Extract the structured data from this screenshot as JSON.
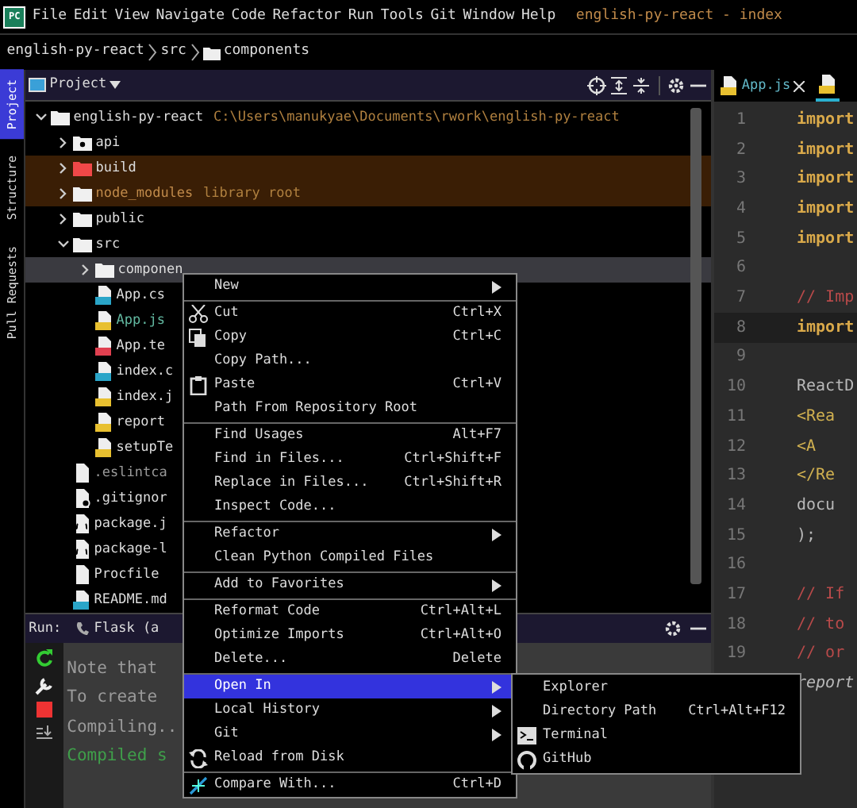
{
  "app_logo": "PC",
  "menu_bar": [
    "File",
    "Edit",
    "View",
    "Navigate",
    "Code",
    "Refactor",
    "Run",
    "Tools",
    "Git",
    "Window",
    "Help"
  ],
  "window": {
    "title": "english-py-react - index"
  },
  "breadcrumb": [
    "english-py-react",
    "src",
    "components"
  ],
  "tool_stripe": [
    {
      "label": "Project",
      "selected": true
    },
    {
      "label": "Structure",
      "selected": false
    },
    {
      "label": "Pull Requests",
      "selected": false
    }
  ],
  "project_panel": {
    "title": "Project",
    "tree": [
      {
        "label": "english-py-react",
        "hint": "C:\\Users\\manukyae\\Documents\\rwork\\english-py-react",
        "kind": "folder",
        "color": "#dddddd",
        "excluded": false,
        "highlighted": false,
        "selected": false,
        "expanded": true,
        "children": [
          {
            "label": "api",
            "kind": "package",
            "color": "#dddddd",
            "excluded": false,
            "highlighted": false,
            "selected": false,
            "expanded": false
          },
          {
            "label": "build",
            "kind": "folder",
            "color": "#dddddd",
            "excluded": true,
            "highlighted": true,
            "selected": false,
            "expanded": false
          },
          {
            "label": "node_modules",
            "hint": "library root",
            "kind": "folder",
            "color": "#c08a4a",
            "excluded": false,
            "highlighted": true,
            "selected": false,
            "expanded": false
          },
          {
            "label": "public",
            "kind": "folder",
            "color": "#dddddd",
            "excluded": false,
            "highlighted": false,
            "selected": false,
            "expanded": false
          },
          {
            "label": "src",
            "kind": "folder",
            "color": "#dddddd",
            "excluded": false,
            "highlighted": false,
            "selected": false,
            "expanded": true,
            "children": [
              {
                "label": "componen",
                "kind": "folder",
                "color": "#dddddd",
                "excluded": false,
                "highlighted": false,
                "selected": true,
                "expanded": false
              },
              {
                "label": "App.cs",
                "kind": "css",
                "color": "#dddddd",
                "excluded": false,
                "highlighted": false,
                "selected": false
              },
              {
                "label": "App.js",
                "kind": "js",
                "color": "#62b8a0",
                "excluded": false,
                "highlighted": false,
                "selected": false
              },
              {
                "label": "App.te",
                "kind": "test",
                "color": "#dddddd",
                "excluded": false,
                "highlighted": false,
                "selected": false
              },
              {
                "label": "index.c",
                "kind": "css",
                "color": "#dddddd",
                "excluded": false,
                "highlighted": false,
                "selected": false
              },
              {
                "label": "index.j",
                "kind": "js",
                "color": "#dddddd",
                "excluded": false,
                "highlighted": false,
                "selected": false
              },
              {
                "label": "report",
                "kind": "js",
                "color": "#dddddd",
                "excluded": false,
                "highlighted": false,
                "selected": false
              },
              {
                "label": "setupTe",
                "kind": "js",
                "color": "#dddddd",
                "excluded": false,
                "highlighted": false,
                "selected": false
              }
            ]
          },
          {
            "label": ".eslintca",
            "kind": "text",
            "color": "#9a9a9a",
            "excluded": false,
            "highlighted": false,
            "selected": false
          },
          {
            "label": ".gitignor",
            "kind": "ignore",
            "color": "#dddddd",
            "excluded": false,
            "highlighted": false,
            "selected": false
          },
          {
            "label": "package.j",
            "kind": "json",
            "color": "#dddddd",
            "excluded": false,
            "highlighted": false,
            "selected": false
          },
          {
            "label": "package-l",
            "kind": "json",
            "color": "#dddddd",
            "excluded": false,
            "highlighted": false,
            "selected": false
          },
          {
            "label": "Procfile",
            "kind": "text",
            "color": "#dddddd",
            "excluded": false,
            "highlighted": false,
            "selected": false
          },
          {
            "label": "README.md",
            "kind": "md",
            "color": "#dddddd",
            "excluded": false,
            "highlighted": false,
            "selected": false
          }
        ]
      }
    ]
  },
  "run_panel": {
    "label": "Run:",
    "config": "Flask (a",
    "console": [
      {
        "text": "Note that",
        "kind": "info"
      },
      {
        "text": "To create",
        "kind": "info"
      },
      {
        "text": "Compiling..",
        "kind": "info"
      },
      {
        "text": "Compiled s",
        "kind": "success"
      }
    ]
  },
  "editor": {
    "tabs": [
      {
        "label": "App.js",
        "selected": false
      },
      {
        "selected": true
      }
    ],
    "lines": [
      {
        "number": "1",
        "code": "import",
        "kind": "keyword",
        "selected": false
      },
      {
        "number": "2",
        "code": "import",
        "kind": "keyword",
        "selected": false
      },
      {
        "number": "3",
        "code": "import",
        "kind": "keyword",
        "selected": false
      },
      {
        "number": "4",
        "code": "import",
        "kind": "keyword",
        "selected": false
      },
      {
        "number": "5",
        "code": "import",
        "kind": "keyword",
        "selected": false
      },
      {
        "number": "6",
        "selected": false
      },
      {
        "number": "7",
        "code": "// Imp",
        "kind": "comment",
        "selected": false
      },
      {
        "number": "8",
        "code": "import",
        "kind": "keyword",
        "selected": true
      },
      {
        "number": "9",
        "selected": false
      },
      {
        "number": "10",
        "code": "ReactD",
        "kind": "plain",
        "selected": false
      },
      {
        "number": "11",
        "code": "  <Rea",
        "kind": "tag",
        "selected": false
      },
      {
        "number": "12",
        "code": "    <A",
        "kind": "tag",
        "selected": false
      },
      {
        "number": "13",
        "code": "  </Re",
        "kind": "tag",
        "selected": false
      },
      {
        "number": "14",
        "code": "  docu",
        "kind": "plain",
        "selected": false
      },
      {
        "number": "15",
        "code": ");",
        "kind": "plain",
        "selected": false
      },
      {
        "number": "16",
        "selected": false
      },
      {
        "number": "17",
        "code": "// If",
        "kind": "comment",
        "selected": false
      },
      {
        "number": "18",
        "code": "// to",
        "kind": "comment",
        "selected": false
      },
      {
        "number": "19",
        "code": "// or",
        "kind": "comment",
        "selected": false
      },
      {
        "code": "report",
        "kind": "italic",
        "selected": false
      }
    ]
  },
  "context_menu": {
    "groups": [
      [
        {
          "label": "New",
          "submenu": true,
          "selected": false
        }
      ],
      [
        {
          "label": "Cut",
          "shortcut": "Ctrl+X",
          "kind": "cut",
          "selected": false
        },
        {
          "label": "Copy",
          "shortcut": "Ctrl+C",
          "kind": "copy",
          "selected": false
        },
        {
          "label": "Copy Path...",
          "selected": false
        },
        {
          "label": "Paste",
          "shortcut": "Ctrl+V",
          "kind": "paste",
          "selected": false
        },
        {
          "label": "Path From Repository Root",
          "selected": false
        }
      ],
      [
        {
          "label": "Find Usages",
          "shortcut": "Alt+F7",
          "selected": false
        },
        {
          "label": "Find in Files...",
          "shortcut": "Ctrl+Shift+F",
          "selected": false
        },
        {
          "label": "Replace in Files...",
          "shortcut": "Ctrl+Shift+R",
          "selected": false
        },
        {
          "label": "Inspect Code...",
          "selected": false
        }
      ],
      [
        {
          "label": "Refactor",
          "submenu": true,
          "selected": false
        },
        {
          "label": "Clean Python Compiled Files",
          "selected": false
        }
      ],
      [
        {
          "label": "Add to Favorites",
          "submenu": true,
          "selected": false
        }
      ],
      [
        {
          "label": "Reformat Code",
          "shortcut": "Ctrl+Alt+L",
          "selected": false
        },
        {
          "label": "Optimize Imports",
          "shortcut": "Ctrl+Alt+O",
          "selected": false
        },
        {
          "label": "Delete...",
          "shortcut": "Delete",
          "selected": false
        }
      ],
      [
        {
          "label": "Open In",
          "submenu": true,
          "selected": true
        },
        {
          "label": "Local History",
          "submenu": true,
          "selected": false
        },
        {
          "label": "Git",
          "submenu": true,
          "selected": false
        },
        {
          "label": "Reload from Disk",
          "kind": "reload",
          "selected": false
        }
      ],
      [
        {
          "label": "Compare With...",
          "shortcut": "Ctrl+D",
          "kind": "compare",
          "selected": false
        }
      ]
    ]
  },
  "submenu": [
    {
      "label": "Explorer"
    },
    {
      "label": "Directory Path",
      "shortcut": "Ctrl+Alt+F12"
    },
    {
      "label": "Terminal",
      "kind": "terminal"
    },
    {
      "label": "GitHub",
      "kind": "github"
    }
  ]
}
